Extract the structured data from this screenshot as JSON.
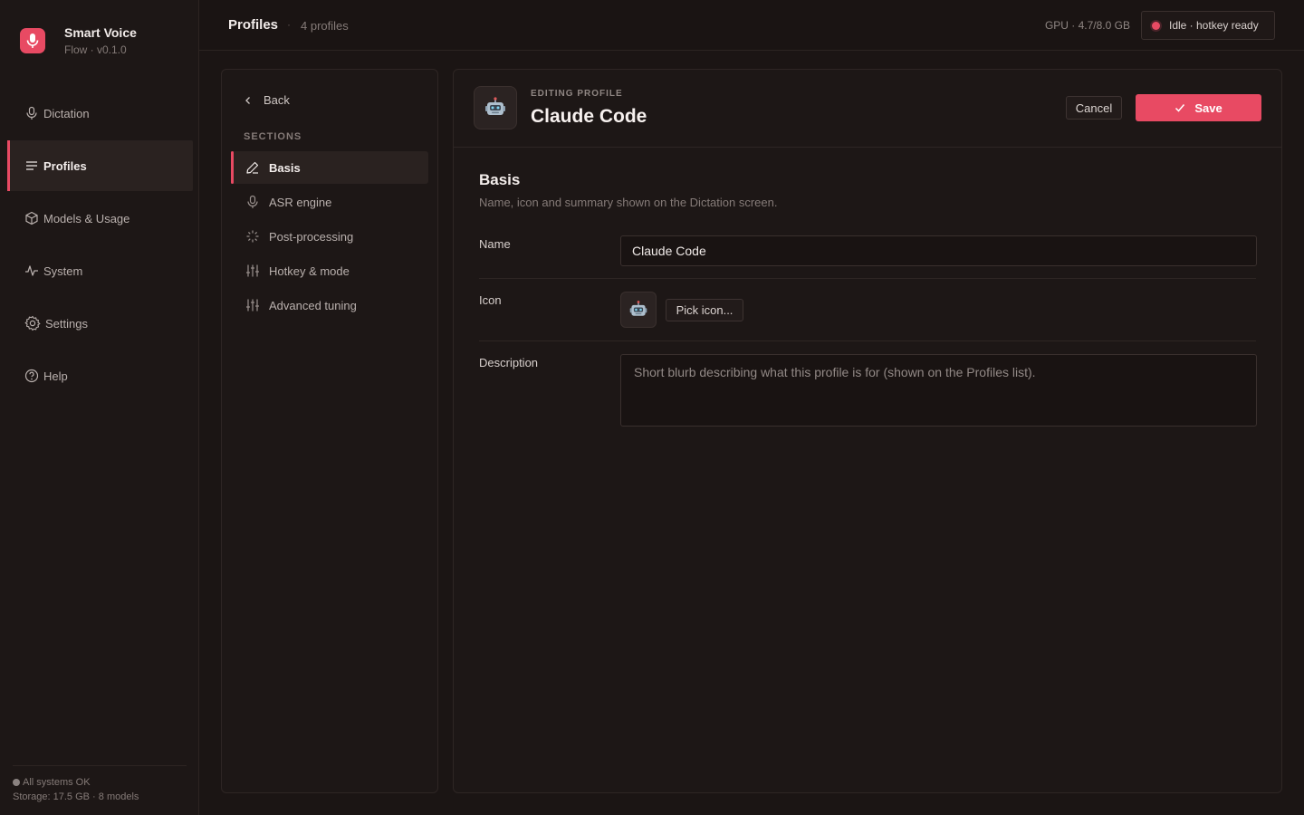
{
  "app": {
    "name": "Smart Voice",
    "subtitle": "Flow · v0.1.0",
    "accent": "#e84a63"
  },
  "sidebar": {
    "items": [
      {
        "label": "Dictation",
        "icon": "mic-icon",
        "active": false
      },
      {
        "label": "Profiles",
        "icon": "lines-icon",
        "active": true
      },
      {
        "label": "Models & Usage",
        "icon": "cube-icon",
        "active": false
      },
      {
        "label": "System",
        "icon": "activity-icon",
        "active": false
      },
      {
        "label": "Settings",
        "icon": "gear-icon",
        "active": false
      },
      {
        "label": "Help",
        "icon": "help-icon",
        "active": false
      }
    ],
    "footer": {
      "status": "All systems OK",
      "storage": "Storage: 17.5 GB · 8 models"
    }
  },
  "topbar": {
    "title": "Profiles",
    "separator": "·",
    "count": "4 profiles",
    "gpu": "GPU · 4.7/8.0 GB",
    "status": "Idle · hotkey ready"
  },
  "sections": {
    "back_label": "Back",
    "heading": "SECTIONS",
    "items": [
      {
        "label": "Basis",
        "icon": "pencil-icon",
        "active": true
      },
      {
        "label": "ASR engine",
        "icon": "mic-icon",
        "active": false
      },
      {
        "label": "Post-processing",
        "icon": "sparkle-icon",
        "active": false
      },
      {
        "label": "Hotkey & mode",
        "icon": "sliders-icon",
        "active": false
      },
      {
        "label": "Advanced tuning",
        "icon": "sliders-icon",
        "active": false
      }
    ]
  },
  "editor": {
    "kicker": "EDITING PROFILE",
    "title": "Claude Code",
    "icon": "robot-icon",
    "cancel_label": "Cancel",
    "save_label": "Save",
    "section_title": "Basis",
    "section_desc": "Name, icon and summary shown on the Dictation screen.",
    "fields": {
      "name_label": "Name",
      "name_value": "Claude Code",
      "icon_label": "Icon",
      "pick_icon_label": "Pick icon...",
      "description_label": "Description",
      "description_placeholder": "Short blurb describing what this profile is for (shown on the Profiles list)."
    }
  }
}
